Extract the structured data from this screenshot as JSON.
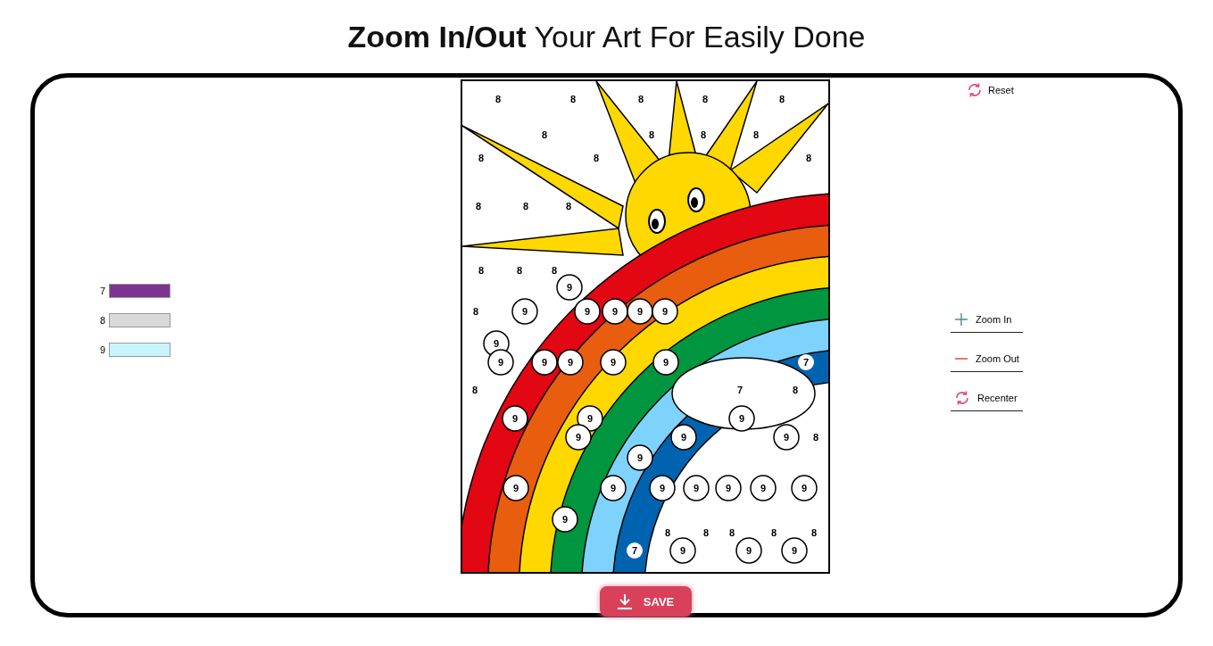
{
  "headline": "**Zoom In/Out** Your Art For Easily Done",
  "palette": [
    {
      "number": "7",
      "color": "#7b3590"
    },
    {
      "number": "8",
      "color": "#d9d9d9"
    },
    {
      "number": "9",
      "color": "#c8f4fb"
    }
  ],
  "region_numbers": [
    "8",
    "8",
    "8",
    "8",
    "8",
    "8",
    "8",
    "8",
    "8",
    "8",
    "8",
    "8",
    "8",
    "8",
    "8",
    "8",
    "8",
    "8",
    "9",
    "8",
    "9",
    "9",
    "9",
    "9",
    "9",
    "9",
    "9",
    "9",
    "9",
    "9",
    "9",
    "7",
    "8",
    "7",
    "8",
    "9",
    "9",
    "9",
    "9",
    "9",
    "9",
    "8",
    "9",
    "9",
    "9",
    "9",
    "9",
    "9",
    "9",
    "9",
    "9",
    "8",
    "8",
    "8",
    "8",
    "8",
    "7",
    "9",
    "9",
    "9"
  ],
  "reset": {
    "label": "Reset"
  },
  "controls": [
    {
      "kind": "zoom_in",
      "label": "Zoom In"
    },
    {
      "kind": "zoom_out",
      "label": "Zoom Out"
    },
    {
      "kind": "recenter",
      "label": "Recenter"
    }
  ],
  "save_button": {
    "label": "SAVE"
  }
}
